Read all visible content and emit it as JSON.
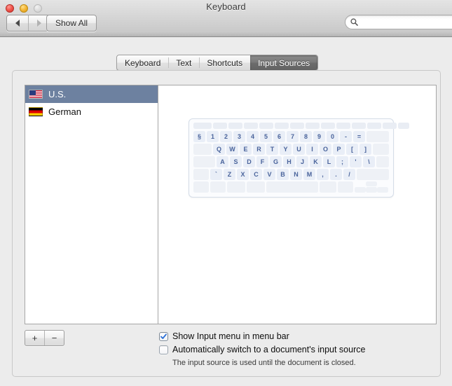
{
  "window": {
    "title": "Keyboard",
    "traffic_lights": [
      "close-button",
      "minimize-button",
      "zoom-button"
    ]
  },
  "toolbar": {
    "back_icon": "triangle-left-icon",
    "forward_icon": "triangle-right-icon",
    "show_all_label": "Show All",
    "search": {
      "icon": "search-icon",
      "value": "",
      "placeholder": ""
    }
  },
  "tabs": [
    {
      "label": "Keyboard",
      "selected": false
    },
    {
      "label": "Text",
      "selected": false
    },
    {
      "label": "Shortcuts",
      "selected": false
    },
    {
      "label": "Input Sources",
      "selected": true
    }
  ],
  "input_sources": [
    {
      "label": "U.S.",
      "flag": "flag-us-icon",
      "selected": true
    },
    {
      "label": "German",
      "flag": "flag-de-icon",
      "selected": false
    }
  ],
  "list_controls": {
    "add_label": "+",
    "remove_label": "−"
  },
  "keyboard_preview": {
    "layout_name": "U.S.",
    "rows": [
      {
        "type": "function",
        "keys": [
          "",
          "",
          "",
          "",
          "",
          "",
          "",
          "",
          "",
          "",
          "",
          "",
          "",
          ""
        ]
      },
      {
        "type": "number",
        "keys": [
          "§",
          "1",
          "2",
          "3",
          "4",
          "5",
          "6",
          "7",
          "8",
          "9",
          "0",
          "-",
          "=",
          ""
        ]
      },
      {
        "type": "letters",
        "keys": [
          "",
          "Q",
          "W",
          "E",
          "R",
          "T",
          "Y",
          "U",
          "I",
          "O",
          "P",
          "[",
          "]"
        ]
      },
      {
        "type": "letters",
        "keys": [
          "",
          "A",
          "S",
          "D",
          "F",
          "G",
          "H",
          "J",
          "K",
          "L",
          ";",
          "'",
          "\\"
        ]
      },
      {
        "type": "letters",
        "keys": [
          "",
          "`",
          "Z",
          "X",
          "C",
          "V",
          "B",
          "N",
          "M",
          ",",
          ".",
          "/"
        ]
      },
      {
        "type": "modifiers",
        "keys": [
          "",
          "",
          "",
          "",
          "",
          "",
          "",
          "",
          ""
        ]
      }
    ]
  },
  "options": {
    "show_input_menu": {
      "label": "Show Input menu in menu bar",
      "checked": true
    },
    "auto_switch": {
      "label": "Automatically switch to a document's input source",
      "checked": false,
      "help": "The input source is used until the document is closed."
    }
  },
  "colors": {
    "selection": "#6d81a0",
    "tab_selected": "#6d6d6d",
    "key_text": "#49639b",
    "key_bg": "#e9eef7"
  }
}
